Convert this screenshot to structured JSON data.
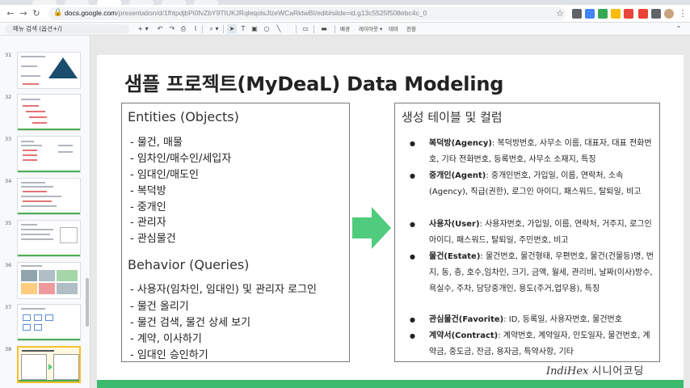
{
  "browser": {
    "url_host": "docs.google.com",
    "url_path": "/presentation/d/1fhtpdjbPi0fvZbY9TIUKJRqleqolsJlzeWCaRktwBI/edit#slide=id.g13c5525f508ebc4c_0",
    "back_icon": "left-arrow-icon",
    "forward_icon": "right-arrow-icon",
    "reload_icon": "reload-icon"
  },
  "toolbar": {
    "menu_search": "메뉴 검색 (옵션+/)",
    "background_label": "배경",
    "layout_label": "레이아웃 ▾",
    "theme_label": "테마",
    "transition_label": "전환"
  },
  "filmstrip": {
    "slides": [
      {
        "num": "31"
      },
      {
        "num": "32"
      },
      {
        "num": "33"
      },
      {
        "num": "34"
      },
      {
        "num": "35"
      },
      {
        "num": "36"
      },
      {
        "num": "37"
      },
      {
        "num": "38",
        "active": true
      }
    ]
  },
  "slide": {
    "title": "샘플 프로젝트(MyDeaL) Data Modeling",
    "entities_heading": "Entities (Objects)",
    "entities": [
      "- 물건, 매물",
      "- 임차인/매수인/세입자",
      "- 임대인/매도인",
      "- 복덕방",
      "- 중개인",
      "- 관리자",
      "- 관심물건"
    ],
    "behavior_heading": "Behavior (Queries)",
    "behaviors": [
      "- 사용자(임차인, 임대인) 및 관리자 로그인",
      "- 물건 올리기",
      "- 물건 검색, 물건 상세 보기",
      "- 계약, 이사하기",
      "- 임대인 승인하기"
    ],
    "tables_heading": "생성 테이블 및 컬럼",
    "tables": [
      {
        "name": "복덕방(Agency)",
        "cols": ": 복덕방번호, 사무소 이름, 대표자, 대표 전화번호, 기타 전화번호, 등록번호, 사무소 소재지, 특징"
      },
      {
        "name": "중개인(Agent)",
        "cols": ": 중개인번호, 가입일, 이름, 연락처, 소속(Agency), 직급(권한), 로그인 아이디, 패스워드, 탈퇴일, 비고"
      },
      {
        "name": "사용자(User)",
        "cols": ": 사용자번호, 가입일, 이름, 연락처, 거주지, 로그인 아이디, 패스워드, 탈퇴일, 주민번호, 비고"
      },
      {
        "name": "물건(Estate)",
        "cols": ": 물건번호, 물건형태, 우편번호, 물건(건물등)명, 번지, 동, 층, 호수,임차인, 크기, 금액, 월세, 관리비, 날짜(이사)방수, 욕실수, 주차,    담당중개인, 용도(주거,업무용), 특징"
      },
      {
        "name": "관심물건(Favorite)",
        "cols": ": ID, 등록일, 사용자번호, 물건번호"
      },
      {
        "name": "계약서(Contract)",
        "cols": ": 계약번호, 계약일자, 인도일자, 물건번호, 계약금, 중도금, 잔금, 용자금, 특약사항, 기타"
      }
    ],
    "bullet_char": "●",
    "watermark_latin": "IndiHex",
    "watermark_korean": "시니어코딩",
    "arrow_color": "#4fcc7d",
    "bar_color": "#3cba6e"
  }
}
